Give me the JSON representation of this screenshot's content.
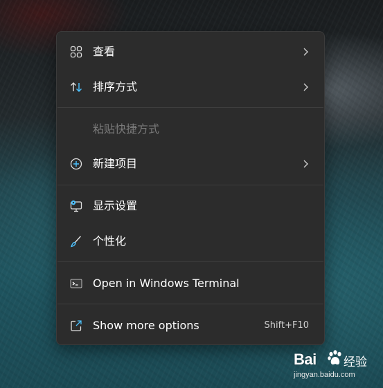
{
  "context_menu": {
    "items": [
      {
        "label": "查看",
        "icon": "grid-view-icon",
        "submenu": true
      },
      {
        "label": "排序方式",
        "icon": "sort-arrows-icon",
        "submenu": true
      },
      {
        "label": "粘贴快捷方式",
        "icon": "",
        "disabled": true
      },
      {
        "label": "新建项目",
        "icon": "add-circle-icon",
        "submenu": true
      },
      {
        "label": "显示设置",
        "icon": "display-settings-icon"
      },
      {
        "label": "个性化",
        "icon": "brush-icon"
      },
      {
        "label": "Open in Windows Terminal",
        "icon": "terminal-icon"
      },
      {
        "label": "Show more options",
        "icon": "open-external-icon",
        "accelerator": "Shift+F10"
      }
    ]
  },
  "watermark": {
    "brand_latin": "Bai",
    "brand_cn": "经验",
    "url": "jingyan.baidu.com"
  },
  "colors": {
    "menu_bg": "#2c2c2c",
    "accent_blue": "#4cc2ff",
    "text": "#ffffff",
    "disabled_text": "#7a7a7a"
  }
}
